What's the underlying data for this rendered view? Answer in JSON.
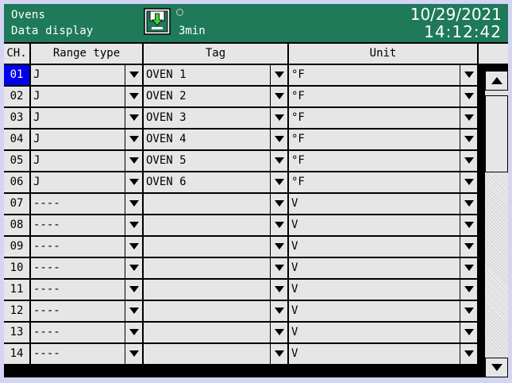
{
  "header": {
    "title": "Ovens",
    "subtitle": "Data display",
    "save_icon": "memory-save-icon",
    "interval": "3min",
    "date": "10/29/2021",
    "time": "14:12:42"
  },
  "table": {
    "columns": {
      "ch": "CH.",
      "range": "Range type",
      "tag": "Tag",
      "unit": "Unit"
    },
    "selected_channel": "01",
    "rows": [
      {
        "ch": "01",
        "range": "J",
        "tag": "OVEN 1",
        "unit": "°F"
      },
      {
        "ch": "02",
        "range": "J",
        "tag": "OVEN 2",
        "unit": "°F"
      },
      {
        "ch": "03",
        "range": "J",
        "tag": "OVEN 3",
        "unit": "°F"
      },
      {
        "ch": "04",
        "range": "J",
        "tag": "OVEN 4",
        "unit": "°F"
      },
      {
        "ch": "05",
        "range": "J",
        "tag": "OVEN 5",
        "unit": "°F"
      },
      {
        "ch": "06",
        "range": "J",
        "tag": "OVEN 6",
        "unit": "°F"
      },
      {
        "ch": "07",
        "range": "----",
        "tag": "",
        "unit": "V"
      },
      {
        "ch": "08",
        "range": "----",
        "tag": "",
        "unit": "V"
      },
      {
        "ch": "09",
        "range": "----",
        "tag": "",
        "unit": "V"
      },
      {
        "ch": "10",
        "range": "----",
        "tag": "",
        "unit": "V"
      },
      {
        "ch": "11",
        "range": "----",
        "tag": "",
        "unit": "V"
      },
      {
        "ch": "12",
        "range": "----",
        "tag": "",
        "unit": "V"
      },
      {
        "ch": "13",
        "range": "----",
        "tag": "",
        "unit": "V"
      },
      {
        "ch": "14",
        "range": "----",
        "tag": "",
        "unit": "V"
      }
    ]
  },
  "scrollbar": {
    "position": 0
  },
  "colors": {
    "header_bg": "#1f7a5a",
    "selected_bg": "#0000ee",
    "cell_bg": "#e6e6e6",
    "page_bg": "#d4d4f4"
  }
}
